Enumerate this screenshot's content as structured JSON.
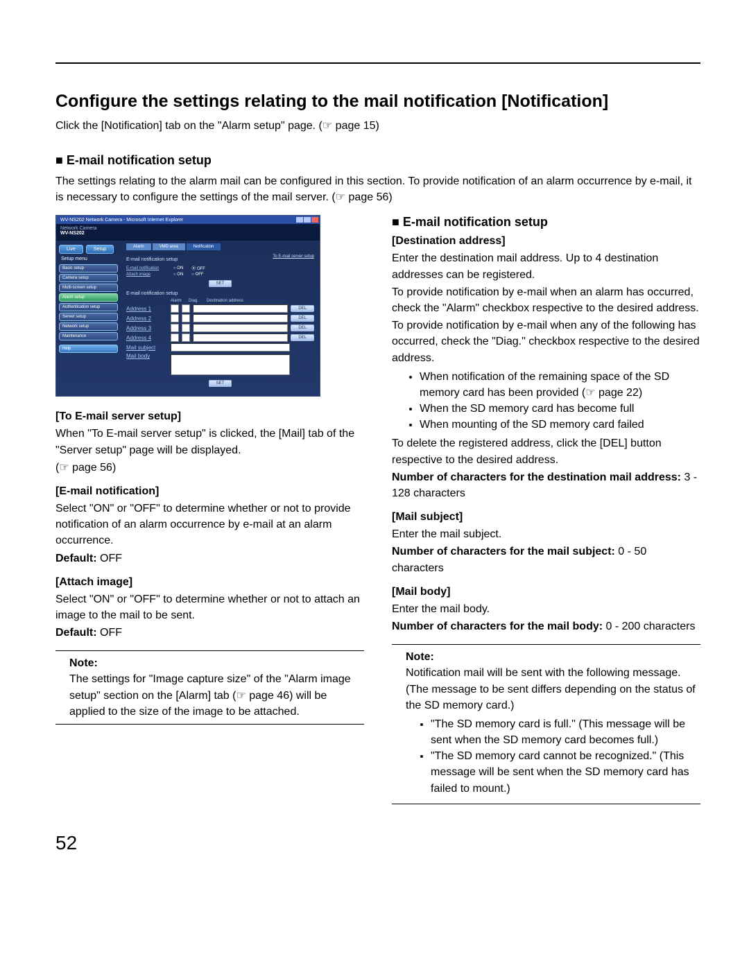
{
  "page": {
    "title": "Configure the settings relating to the mail notification [Notification]",
    "intro": "Click the [Notification] tab on the \"Alarm setup\" page. (☞ page 15)",
    "pageNumber": "52"
  },
  "left": {
    "h2": "E-mail notification setup",
    "h2_desc": "The settings relating to the alarm mail can be configured in this section. To provide notification of an alarm occurrence by e-mail, it is necessary to configure the settings of the mail server. (☞ page 56)",
    "sec1_title": "[To E-mail server setup]",
    "sec1_body": "When \"To E-mail server setup\" is clicked, the [Mail] tab of the \"Server setup\" page will be displayed.",
    "sec1_ref": "(☞ page 56)",
    "sec2_title": "[E-mail notification]",
    "sec2_body": "Select \"ON\" or \"OFF\" to determine whether or not to provide notification of an alarm occurrence by e-mail at an alarm occurrence.",
    "sec2_default_label": "Default:",
    "sec2_default_val": " OFF",
    "sec3_title": "[Attach image]",
    "sec3_body": "Select \"ON\" or \"OFF\" to determine whether or not to attach an image to the mail to be sent.",
    "sec3_default_label": "Default:",
    "sec3_default_val": " OFF",
    "note_label": "Note:",
    "note_body": "The settings for \"Image capture size\" of the \"Alarm image setup\" section on the [Alarm] tab (☞ page 46) will be applied to the size of the image to be attached."
  },
  "right": {
    "h2": "E-mail notification setup",
    "dest_title": "[Destination address]",
    "dest_p1": "Enter the destination mail address. Up to 4 destination addresses can be registered.",
    "dest_p2": "To provide notification by e-mail when an alarm has occurred, check the \"Alarm\" checkbox respective to the desired address.",
    "dest_p3": "To provide notification by e-mail when any of the following has occurred, check the \"Diag.\" checkbox respective to the desired address.",
    "dest_bullets": [
      "When notification of the remaining space of the SD memory card has been provided (☞ page 22)",
      "When the SD memory card has become full",
      "When mounting of the SD memory card failed"
    ],
    "dest_p4": "To delete the registered address, click the [DEL] button respective to the desired address.",
    "dest_count_label": "Number of characters for the destination mail address:",
    "dest_count_val": " 3 - 128 characters",
    "subj_title": "[Mail subject]",
    "subj_p1": "Enter the mail subject.",
    "subj_count_label": "Number of characters for the mail subject:",
    "subj_count_val": " 0 - 50 characters",
    "body_title": "[Mail body]",
    "body_p1": "Enter the mail body.",
    "body_count_label": "Number of characters for the mail body:",
    "body_count_val": " 0 - 200 characters",
    "note_label": "Note:",
    "note_intro": "Notification mail will be sent with the following message. (The message to be sent differs depending on the status of the SD memory card.)",
    "note_bullets": [
      "\"The SD memory card is full.\" (This message will be sent when the SD memory card becomes full.)",
      "\"The SD memory card cannot be recognized.\" (This message will be sent when the SD memory card has failed to mount.)"
    ]
  },
  "screenshot": {
    "wintitle": "WV-NS202 Network Camera - Microsoft Internet Explorer",
    "hdr_sub": "Network Camera",
    "hdr_main": "WV-NS202",
    "nav_live": "Live",
    "nav_setup": "Setup",
    "side_title": "Setup menu",
    "side_items": [
      "Basic setup",
      "Camera setup",
      "Multi-screen setup",
      "Alarm setup",
      "Authentication setup",
      "Server setup",
      "Network setup",
      "Maintenance",
      "Help"
    ],
    "tabs": [
      "Alarm",
      "VMD area",
      "Notification"
    ],
    "sec1": "E-mail notification setup",
    "link_server": "To E-mail server setup",
    "row1_lbl": "E-mail notification",
    "row1_on": "ON",
    "row1_off": "OFF",
    "row2_lbl": "Attach image",
    "row2_on": "ON",
    "row2_off": "OFF",
    "btn_set": "SET",
    "sec2": "E-mail notification setup",
    "th_alarm": "Alarm",
    "th_diag": "Diag.",
    "th_dest": "Destination address",
    "addr_labels": [
      "Address 1",
      "Address 2",
      "Address 3",
      "Address 4"
    ],
    "btn_del": "DEL",
    "lbl_subject": "Mail subject",
    "lbl_body": "Mail body"
  }
}
